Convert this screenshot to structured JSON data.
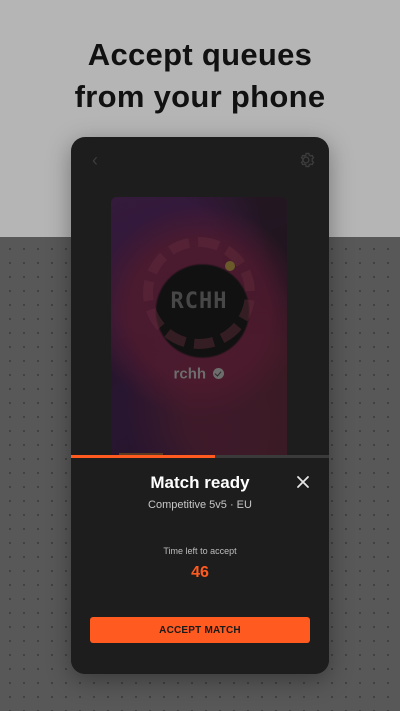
{
  "headline": {
    "line1": "Accept queues",
    "line2": "from your phone"
  },
  "phone": {
    "back_icon": "chevron-left-icon",
    "settings_icon": "gear-icon",
    "profile": {
      "logo_text": "RCHH",
      "name": "rchh",
      "verified_icon": "verified-badge-icon"
    },
    "progress": {
      "fraction": 0.56,
      "color": "#ff5a1f"
    },
    "match_sheet": {
      "title": "Match ready",
      "close_icon": "close-icon",
      "subtitle": "Competitive 5v5 · EU",
      "timer_label": "Time left to accept",
      "timer_value": "46",
      "accept_label": "ACCEPT MATCH",
      "accent_color": "#ff5a1f"
    }
  },
  "colors": {
    "top_background": "#b5b5b5",
    "bottom_background": "#585858",
    "phone_background": "#1d1d1d",
    "accent": "#ff5a1f"
  }
}
